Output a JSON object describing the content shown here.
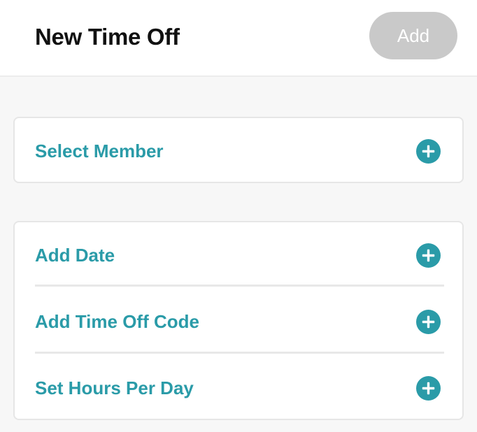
{
  "header": {
    "title": "New Time Off",
    "add_label": "Add"
  },
  "member_card": {
    "label": "Select Member",
    "icon": "plus-circle-icon"
  },
  "details_card": {
    "rows": [
      {
        "label": "Add Date",
        "icon": "plus-circle-icon"
      },
      {
        "label": "Add Time Off Code",
        "icon": "plus-circle-icon"
      },
      {
        "label": "Set Hours Per Day",
        "icon": "plus-circle-icon"
      }
    ]
  },
  "colors": {
    "accent": "#2a9ba8",
    "disabled_button": "#c9c9c9",
    "background": "#f7f7f7"
  }
}
